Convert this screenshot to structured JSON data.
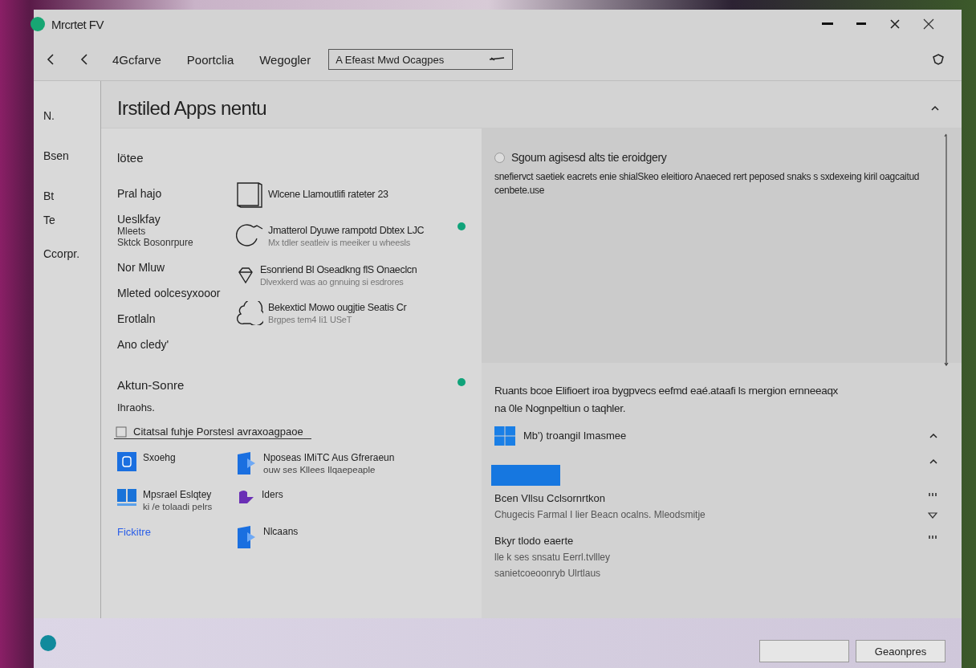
{
  "window": {
    "title": "Mrcrtet FV"
  },
  "toolbar": {
    "nav": [
      "4Gcfarve",
      "Poortclia",
      "Wegogler"
    ],
    "dropdown": {
      "value": "A Efeast Mwd Ocagpes"
    }
  },
  "sidebar": {
    "items": [
      {
        "label": "N.",
        "selected": false
      },
      {
        "label": "Bsen",
        "selected": false
      },
      {
        "label": "Bt",
        "selected": false
      },
      {
        "label": "Te",
        "selected": false
      },
      {
        "label": "Ccorpr.",
        "selected": false
      }
    ]
  },
  "page": {
    "heading": "Irstiled Apps nentu"
  },
  "installed": {
    "heading": "lötee",
    "labels": [
      {
        "text": "Pral hajo"
      },
      {
        "text": "Ueslkfay",
        "lines": [
          "Mleets",
          "Sktck Bosonrpure"
        ]
      },
      {
        "text": "Nor Mluw"
      },
      {
        "text": "Mleted oolcesyxooor"
      },
      {
        "text": "Erotlaln"
      },
      {
        "text": "Ano cledy'"
      }
    ],
    "apps": [
      {
        "kind": "book",
        "title": "Wlcene Llamoutlifi rateter 23",
        "dot": false
      },
      {
        "kind": "circle",
        "title": "Jmatterol Dyuwe rampotd Dbtex LJC",
        "subtitle": "Mx tdler seatleiv is meeiker u wheesls",
        "dot": true
      },
      {
        "kind": "gem",
        "title": "Esonriend Bl Oseadkng flS Onaeclcn",
        "subtitle": "Dlvexkerd was ao gnnuing si esdrores",
        "dot": false
      },
      {
        "kind": "cloud",
        "title": "Bekexticl Mowo ougjtie Seatis Cr",
        "subtitle": "Brgpes tem4 Ii1 USeT",
        "dot": false
      }
    ]
  },
  "store": {
    "heading": "Aktun-Sonre",
    "dot": true,
    "caption": "Ihraohs.",
    "field": {
      "value": "Citatsal fuhje Porstesl avraxoagpaoe"
    },
    "apps": [
      {
        "kind": "square",
        "title": "Sxoehg"
      },
      {
        "kind": "doc",
        "title": "Nposeas IMiTC Aus Gfreraeun",
        "subtitle": "ouw ses Kllees Ilqaepeaple"
      },
      {
        "kind": "panes",
        "title": "Mpsrael Eslqtey",
        "subtitle": "ki /e tolaadi pelrs"
      },
      {
        "kind": "purple",
        "title": "Iders"
      },
      {
        "kind": "link",
        "title": "Fickitre"
      },
      {
        "kind": "doc",
        "title": "Nlcaans"
      }
    ]
  },
  "details": {
    "option": {
      "label": "Sgoum agisesd alts tie eroidgery",
      "selected": false
    },
    "text": "snefiervct saetiek eacrets enie shialSkeo eleitioro Anaeced rert peposed snaks s sxdexeing kiril oagcaitud cenbete.use"
  },
  "info": {
    "text": "Ruants bcoe Elifioert iroa bygpvecs eefmd eaé.ataafi ls rnergion ernneeaqx na 0le Nognpeltiun o taqhler.",
    "product": "Mb') troangil Imasmee",
    "entries": [
      {
        "title": "Bcen Vllsu Cclsornrtkon",
        "lines": [
          "Chugecis Farmal I lier Beacn ocalns. Mleodsmitje"
        ],
        "bar": true
      },
      {
        "title": "Bkyr tlodo eaerte",
        "lines": [
          "lle k ses snsatu Eerrl.tvllley",
          "sanietcoeoonryb Ulrtlaus"
        ],
        "bar": false
      }
    ]
  },
  "footer": {
    "buttons": [
      {
        "kind": "obscured"
      },
      {
        "kind": "text",
        "label": "Geaonpres"
      }
    ]
  }
}
